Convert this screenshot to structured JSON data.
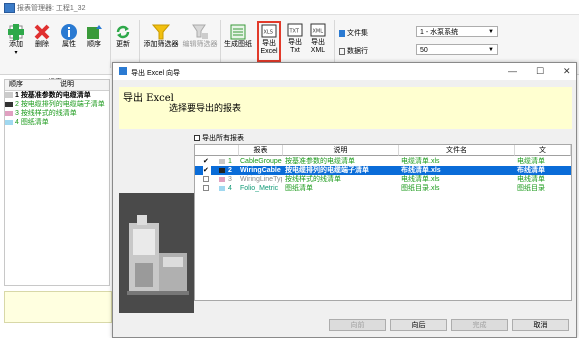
{
  "window": {
    "title": "报表管理器: 工程1_32"
  },
  "ribbon": {
    "add": "添加",
    "delete": "删除",
    "properties": "属性",
    "order": "顺序",
    "group_reports": "报表",
    "update": "更新",
    "add_filter": "添加筛选器",
    "edit_filter": "编辑筛选器",
    "generate_drawing": "生成图纸",
    "export_excel": "导出\nExcel",
    "export_excel_l1": "导出",
    "export_excel_l2": "Excel",
    "export_txt_l1": "导出",
    "export_txt_l2": "Txt",
    "export_xml_l1": "导出",
    "export_xml_l2": "XML",
    "file_set": "文件集",
    "data_rows": "数据行",
    "system_combo": "1 - 水泵系统",
    "rows_combo": "50"
  },
  "left_panel": {
    "col_order": "顺序",
    "col_desc": "说明",
    "rows": [
      {
        "num": "1",
        "text": "按基准参数的电缆清单"
      },
      {
        "num": "2",
        "text": "按电缆排列的电缆端子清单"
      },
      {
        "num": "3",
        "text": "按线样式的线清单"
      },
      {
        "num": "4",
        "text": "图纸清单"
      }
    ]
  },
  "dialog": {
    "title": "导出 Excel 向导",
    "heading": "导出 Excel",
    "subheading": "选择要导出的报表",
    "export_all_label": "导出所有报表",
    "columns": [
      "报表",
      "说明",
      "文件名",
      "文"
    ],
    "rows": [
      {
        "checked": "✔",
        "num": "1",
        "report": "CableGrouped",
        "desc": "按基准参数的电缆清单",
        "file": "电缆清单.xls",
        "extra": "电缆清单"
      },
      {
        "checked": "✔",
        "num": "2",
        "report": "WiringCable",
        "desc": "按电缆排列的电缆端子清单",
        "file": "布线清单.xls",
        "extra": "布线清单"
      },
      {
        "checked": "",
        "num": "3",
        "report": "WiringLineTyp",
        "desc": "按线样式的线清单",
        "file": "电线清单.xls",
        "extra": "电线清单"
      },
      {
        "checked": "",
        "num": "4",
        "report": "Folio_Metric",
        "desc": "图纸清单",
        "file": "图纸目录.xls",
        "extra": "图纸目录"
      }
    ],
    "buttons": {
      "back": "向前",
      "next": "向后",
      "finish": "完成",
      "cancel": "取消"
    }
  },
  "colors": {
    "accent": "#0a6cd8",
    "header_bg": "#ffffd0",
    "highlight_border": "#e23a2a"
  }
}
